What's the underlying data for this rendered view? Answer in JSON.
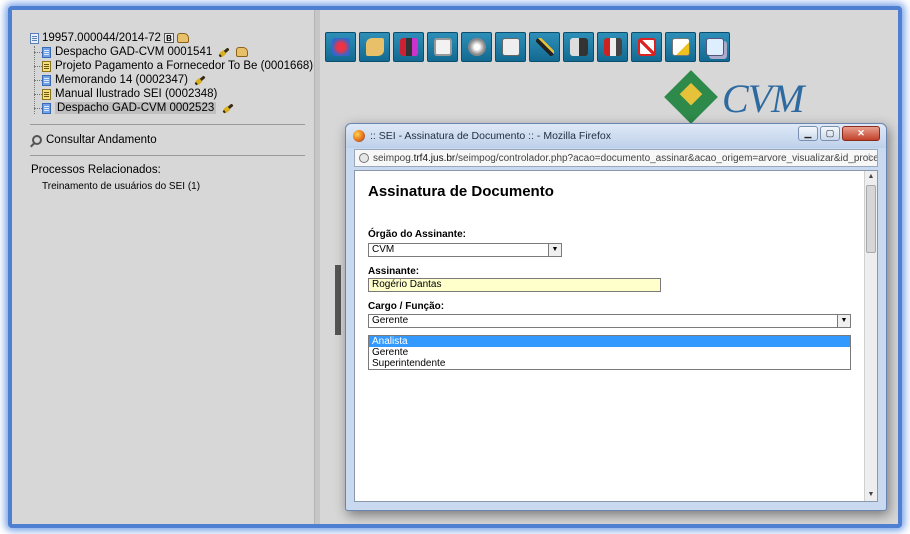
{
  "left_panel": {
    "process_number": "19957.000044/2014-72",
    "process_badge": "B",
    "tree_items": [
      {
        "label": "Despacho GAD-CVM 0001541",
        "icon": "blue"
      },
      {
        "label": "Projeto Pagamento a Fornecedor To Be (0001668)",
        "icon": "yellow"
      },
      {
        "label": "Memorando 14 (0002347)",
        "icon": "blue"
      },
      {
        "label": "Manual Ilustrado SEI (0002348)",
        "icon": "yellow"
      },
      {
        "label": "Despacho GAD-CVM 0002523",
        "icon": "blue"
      }
    ],
    "consultar_andamento": "Consultar Andamento",
    "processos_relacionados_title": "Processos Relacionados:",
    "processo_relacionado_item": "Treinamento de usuários do SEI (1)"
  },
  "logo": {
    "text": "CVM"
  },
  "popup": {
    "window_title": ":: SEI - Assinatura de Documento :: - Mozilla Firefox",
    "url_prefix": "seimpog.",
    "url_domain": "trf4.jus.br",
    "url_path": "/seimpog/controlador.php?acao=documento_assinar&acao_origem=arvore_visualizar&id_procedimer",
    "min_label": "▁",
    "max_label": "▢",
    "close_label": "✕",
    "form_title": "Assinatura de Documento",
    "orgao_label": "Órgão do Assinante:",
    "orgao_value": "CVM",
    "assinante_label": "Assinante:",
    "assinante_value": "Rogério Dantas",
    "cargo_label": "Cargo / Função:",
    "cargo_value": "Gerente",
    "cargo_options": [
      "Analista",
      "Gerente",
      "Superintendente"
    ],
    "cargo_highlighted": "Analista"
  },
  "colors": {
    "frame": "#4f7fd0",
    "toolbar_button": "#1e7ba6",
    "assinante_bg": "#ffffcc",
    "dropdown_highlight": "#3399ff"
  }
}
